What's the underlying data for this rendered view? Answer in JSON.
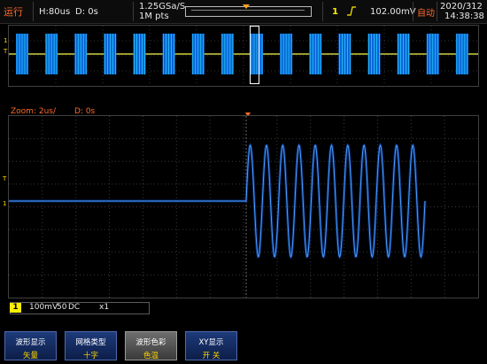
{
  "top_bar": {
    "run_status": "运行",
    "horizontal_scale": "H:80us",
    "horizontal_delay": "D: 0s",
    "sample_rate": "1.25GSa/S",
    "memory_depth": "1M pts",
    "trigger_channel": "1",
    "trigger_level": "102.00mV",
    "trigger_mode": "自动",
    "date": "2020/312",
    "time": "14:38:38"
  },
  "overview": {
    "burst_count": 16
  },
  "zoom": {
    "label": "Zoom: 2us/",
    "delay": "D: 0s"
  },
  "channel": {
    "badge": "1",
    "scale": "100mV",
    "impedance": "50",
    "coupling": "DC",
    "probe": "x1"
  },
  "softkeys": [
    {
      "title": "波形显示",
      "value": "矢量"
    },
    {
      "title": "网格类型",
      "value": "十字"
    },
    {
      "title": "波形色彩",
      "value": "色温"
    },
    {
      "title": "XY显示",
      "value": "开     关"
    }
  ],
  "colors": {
    "accent": "#ff6a2a",
    "channel1": "#ffee00",
    "trace": "#1e78ff",
    "softkey": "#1d3a7a"
  },
  "icons": {
    "trigger_edge": "rising-edge-icon"
  }
}
